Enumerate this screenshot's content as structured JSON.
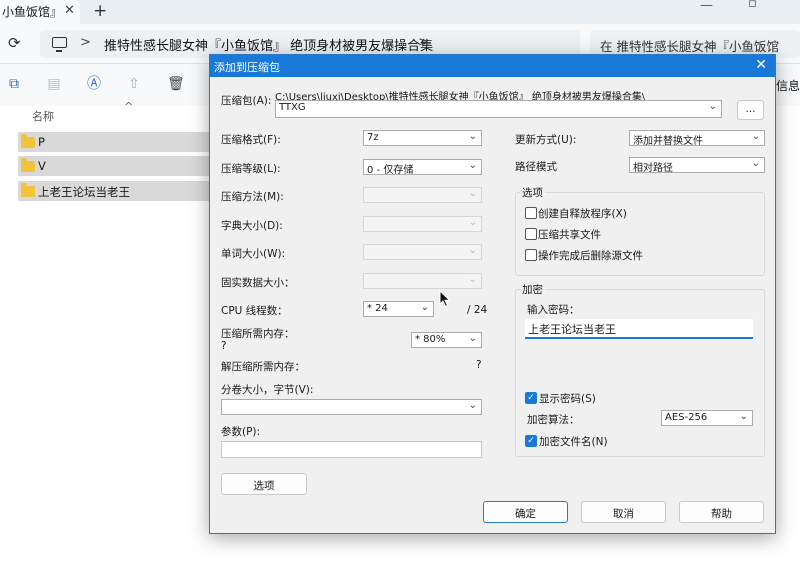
{
  "explorer": {
    "tab_title": "小鱼饭馆』",
    "tab_close": "✕",
    "tab_add": "+",
    "breadcrumb": "推特性感长腿女神『小鱼饭馆』 绝顶身材被男友爆操合集",
    "search_placeholder": "在 推特性感长腿女神『小鱼饭馆",
    "info_label": "信息",
    "column_name": "名称",
    "sort_arrow": "^",
    "folders": [
      {
        "name": "P"
      },
      {
        "name": "V"
      },
      {
        "name": "上老王论坛当老王"
      }
    ]
  },
  "dialog": {
    "title": "添加到压缩包",
    "close": "✕",
    "archive_label": "压缩包(A):",
    "archive_path": "C:\\Users\\liuxi\\Desktop\\推特性感长腿女神『小鱼饭馆』 绝顶身材被男友爆操合集\\",
    "archive_name": "TTXG",
    "browse_label": "...",
    "format_label": "压缩格式(F):",
    "format_value": "7z",
    "level_label": "压缩等级(L):",
    "level_value": "0 - 仅存储",
    "method_label": "压缩方法(M):",
    "dict_label": "字典大小(D):",
    "word_label": "单词大小(W):",
    "solid_label": "固实数据大小：",
    "cpu_label": "CPU 线程数：",
    "cpu_value": "* 24",
    "cpu_total": "/ 24",
    "mem_label": "压缩所需内存：",
    "mem_q": "?",
    "mem_value": "* 80%",
    "decomp_label": "解压缩所需内存：",
    "decomp_q": "?",
    "split_label": "分卷大小，字节(V):",
    "params_label": "参数(P):",
    "options_button": "选项",
    "update_label": "更新方式(U):",
    "update_value": "添加并替换文件",
    "pathmode_label": "路径模式",
    "pathmode_value": "相对路径",
    "options_group": "选项",
    "opt_sfx": "创建自释放程序(X)",
    "opt_shared": "压缩共享文件",
    "opt_delete": "操作完成后删除源文件",
    "enc_group": "加密",
    "pw_label": "输入密码：",
    "pw_value": "上老王论坛当老王",
    "show_pw": "显示密码(S)",
    "enc_method_label": "加密算法：",
    "enc_method_value": "AES-256",
    "enc_names": "加密文件名(N)",
    "ok": "确定",
    "cancel": "取消",
    "help": "帮助",
    "check_mark": "✓",
    "dropdown_arrow": "⌄"
  }
}
